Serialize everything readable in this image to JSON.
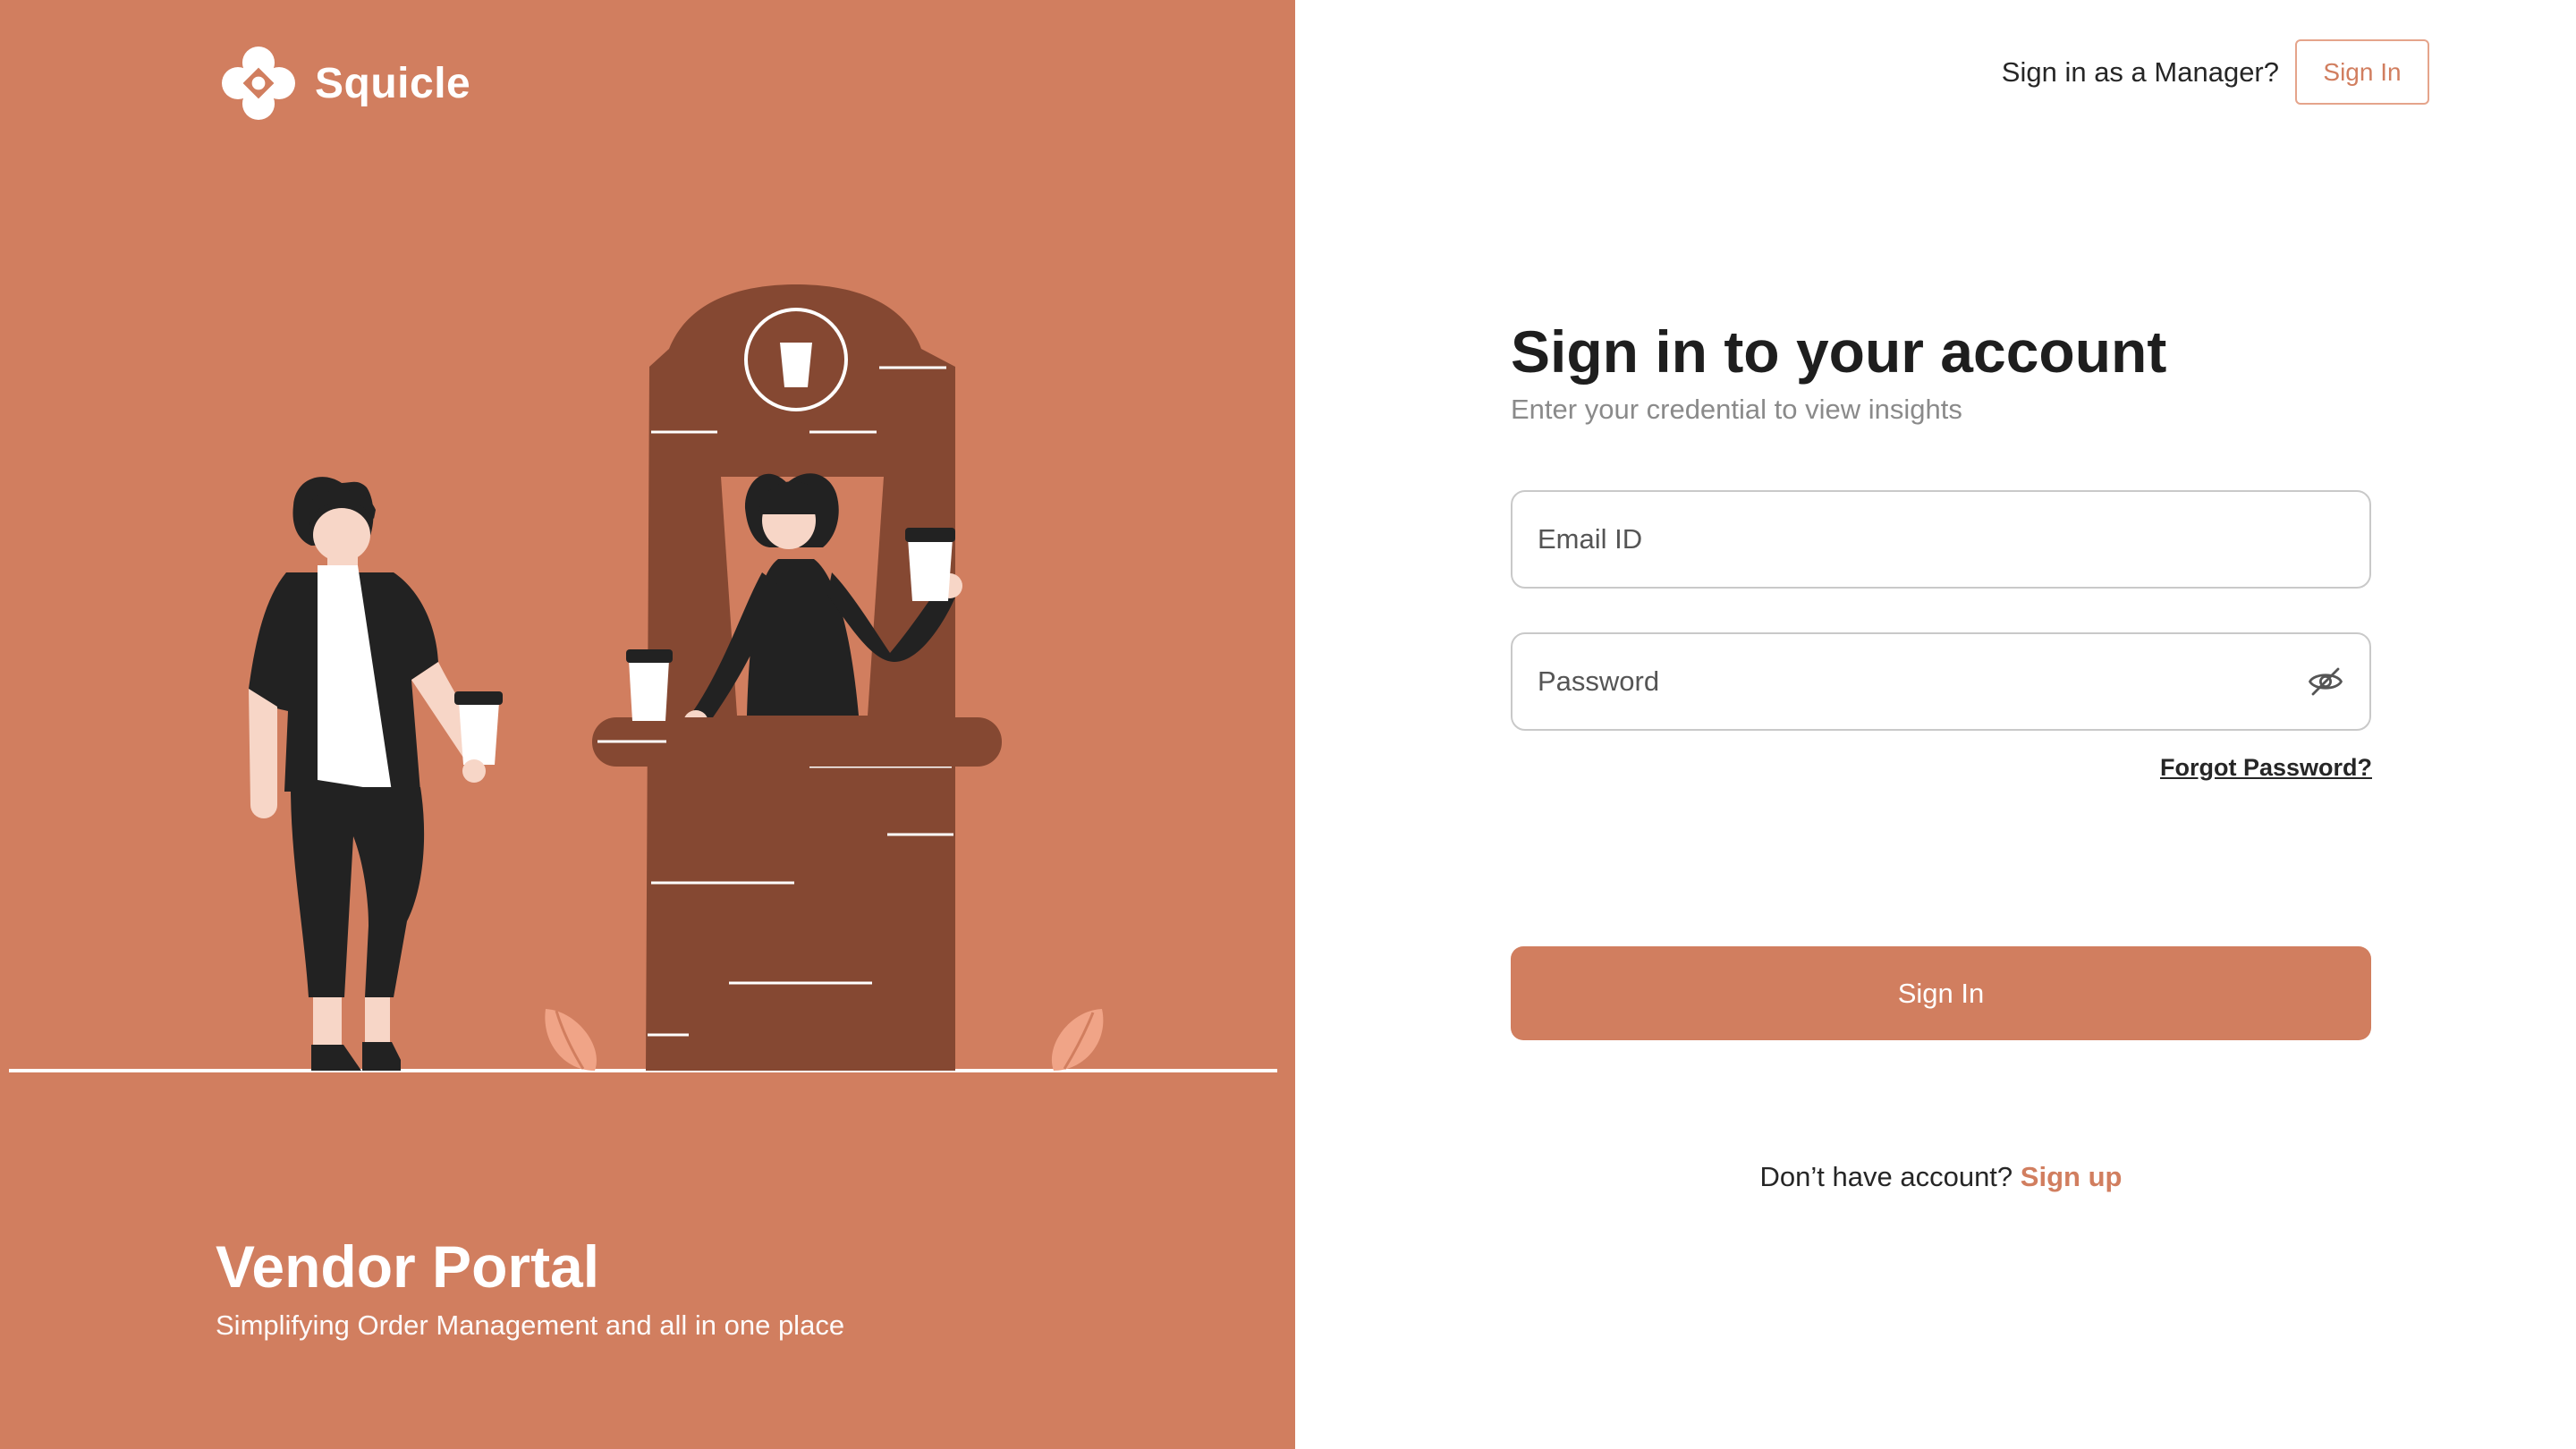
{
  "brand": {
    "name": "Squicle"
  },
  "hero": {
    "title": "Vendor Portal",
    "subtitle": "Simplifying Order Management and all in one place"
  },
  "header": {
    "manager_prompt": "Sign in as a Manager?",
    "manager_button": "Sign In"
  },
  "form": {
    "heading": "Sign in to your account",
    "subheading": "Enter your credential to view insights",
    "email": {
      "placeholder": "Email ID",
      "value": ""
    },
    "password": {
      "placeholder": "Password",
      "value": "",
      "toggle_icon": "eye-off-icon"
    },
    "forgot_label": "Forgot Password?",
    "submit_label": "Sign In",
    "signup_prompt": "Don’t have account?",
    "signup_link": "Sign up"
  },
  "colors": {
    "accent": "#D17E5F",
    "booth": "#854832",
    "leaf": "#F0A487",
    "dark": "#222222"
  }
}
